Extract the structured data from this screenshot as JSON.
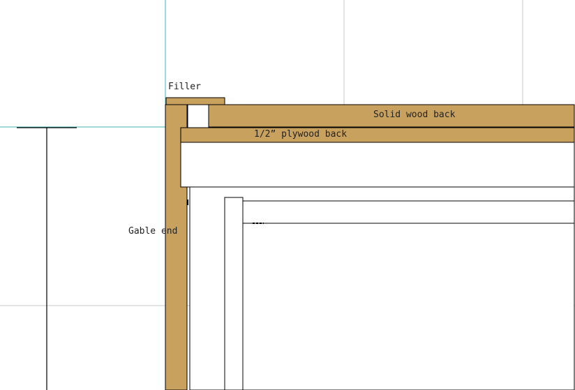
{
  "labels": {
    "filler": "Filler",
    "solid_wood_back": "Solid wood back",
    "plywood_back": "1/2” plywood back",
    "gable_end": "Gable end"
  },
  "colors": {
    "wood": "#c8a15e",
    "outline": "#000000",
    "grid": "#c8c8c8",
    "guide": "#3fb3b3",
    "paper": "#ffffff"
  }
}
